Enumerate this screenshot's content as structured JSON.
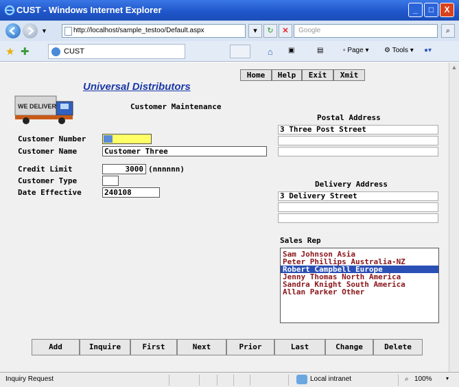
{
  "window": {
    "title": "CUST - Windows Internet Explorer",
    "controls": {
      "minimize": "_",
      "maximize": "□",
      "close": "X"
    }
  },
  "address_bar": {
    "url": "http://localhost/sample_testoo/Default.aspx",
    "search_placeholder": "Google"
  },
  "tab": {
    "label": "CUST"
  },
  "command_bar": {
    "page_label": "Page",
    "tools_label": "Tools"
  },
  "app": {
    "company": "Universal Distributors",
    "logo_text": "WE DELIVER",
    "form_title": "Customer Maintenance",
    "top_buttons": [
      "Home",
      "Help",
      "Exit",
      "Xmit"
    ],
    "fields": {
      "customer_number": {
        "label": "Customer Number",
        "value": ""
      },
      "customer_name": {
        "label": "Customer Name",
        "value": "Customer Three"
      },
      "credit_limit": {
        "label": "Credit Limit",
        "value": "3000",
        "hint": "(nnnnnn)"
      },
      "customer_type": {
        "label": "Customer Type",
        "value": ""
      },
      "date_effective": {
        "label": "Date Effective",
        "value": "240108"
      }
    },
    "postal_address": {
      "heading": "Postal Address",
      "lines": [
        "3 Three Post Street",
        "",
        ""
      ]
    },
    "delivery_address": {
      "heading": "Delivery Address",
      "lines": [
        "3 Delivery Street",
        "",
        ""
      ]
    },
    "sales_rep": {
      "heading": "Sales Rep",
      "options": [
        "Sam Johnson Asia",
        "Peter Phillips Australia-NZ",
        "Robert Campbell Europe",
        "Jenny Thomas North America",
        "Sandra Knight South America",
        "Allan Parker Other"
      ],
      "selected_index": 2
    },
    "bottom_buttons": [
      "Add",
      "Inquire",
      "First",
      "Next",
      "Prior",
      "Last",
      "Change",
      "Delete"
    ]
  },
  "status_bar": {
    "left_text": "Inquiry Request",
    "zone": "Local intranet",
    "zoom": "100%"
  },
  "colors": {
    "title_bar": "#1f55c9",
    "selected_row": "#2a4fb5",
    "sales_text": "#8a1418",
    "company_text": "#1a38a8",
    "input_highlight": "#ffff66"
  }
}
